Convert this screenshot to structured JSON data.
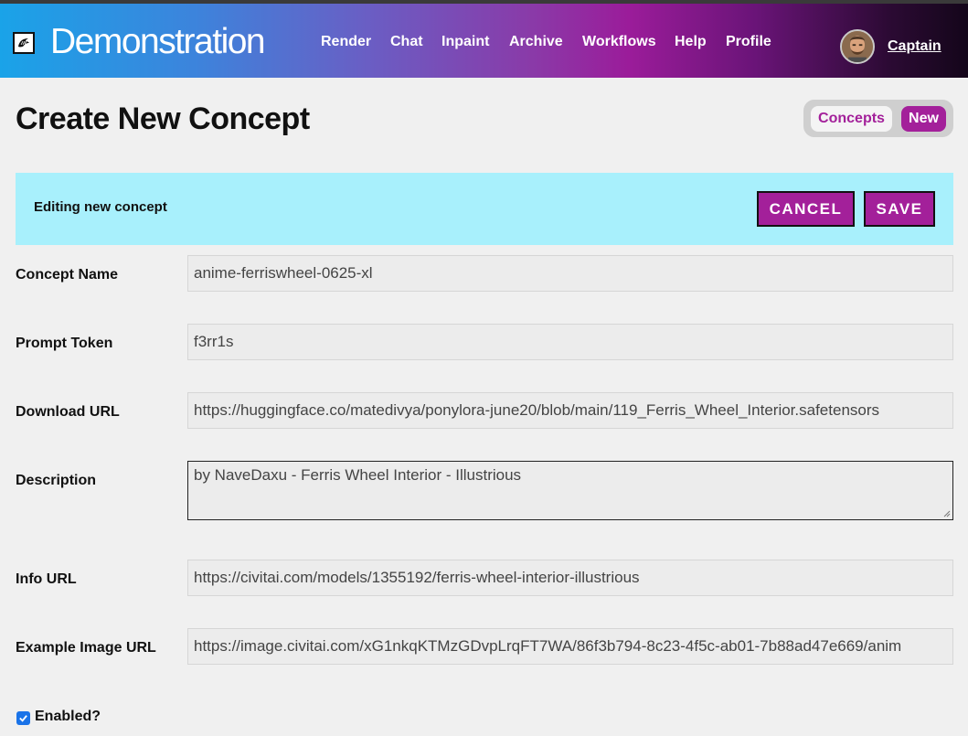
{
  "header": {
    "brand": "Demonstration",
    "nav": [
      {
        "label": "Render",
        "name": "nav-render"
      },
      {
        "label": "Chat",
        "name": "nav-chat"
      },
      {
        "label": "Inpaint",
        "name": "nav-inpaint"
      },
      {
        "label": "Archive",
        "name": "nav-archive"
      },
      {
        "label": "Workflows",
        "name": "nav-workflows"
      },
      {
        "label": "Help",
        "name": "nav-help"
      },
      {
        "label": "Profile",
        "name": "nav-profile"
      }
    ],
    "user": "Captain",
    "logo_icon": "eagle-logo-icon",
    "avatar_icon": "user-avatar"
  },
  "page": {
    "title": "Create New Concept",
    "tabs": {
      "concepts": "Concepts",
      "new": "New"
    }
  },
  "banner": {
    "text": "Editing new concept",
    "cancel": "CANCEL",
    "save": "SAVE"
  },
  "form": {
    "concept_name": {
      "label": "Concept Name",
      "value": "anime-ferriswheel-0625-xl"
    },
    "prompt_token": {
      "label": "Prompt Token",
      "value": "f3rr1s"
    },
    "download_url": {
      "label": "Download URL",
      "value": "https://huggingface.co/matedivya/ponylora-june20/blob/main/119_Ferris_Wheel_Interior.safetensors"
    },
    "description": {
      "label": "Description",
      "value": "by NaveDaxu - Ferris Wheel Interior - Illustrious"
    },
    "info_url": {
      "label": "Info URL",
      "value": "https://civitai.com/models/1355192/ferris-wheel-interior-illustrious"
    },
    "example_image_url": {
      "label": "Example Image URL",
      "value": "https://image.civitai.com/xG1nkqKTMzGDvpLrqFT7WA/86f3b794-8c23-4f5c-ab01-7b88ad47e669/anim"
    },
    "enabled": {
      "label": "Enabled?",
      "checked": true
    }
  },
  "colors": {
    "accent": "#a3209a",
    "banner": "#a8f0fc",
    "checkbox": "#1a73e8"
  }
}
